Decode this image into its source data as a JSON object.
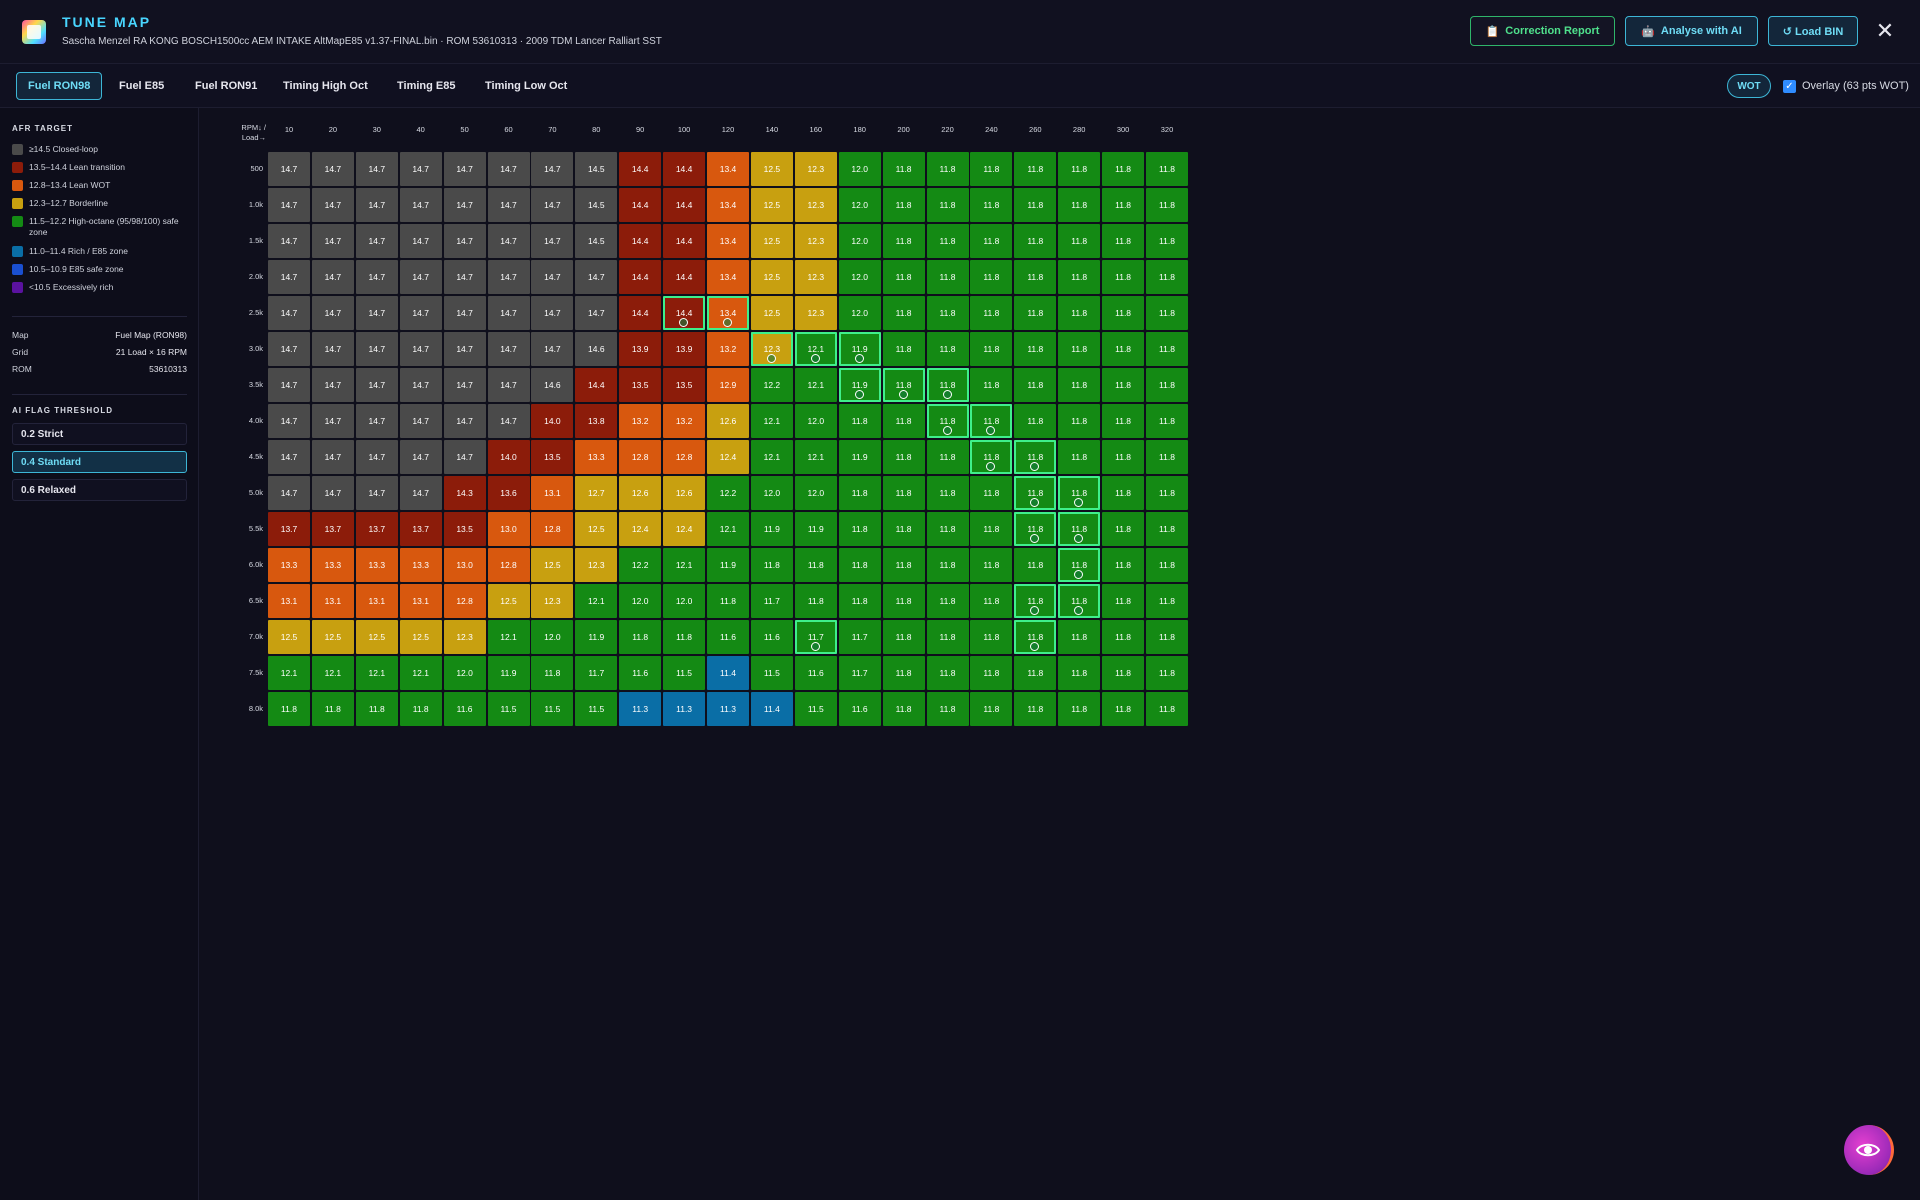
{
  "app": {
    "title": "TUNE MAP",
    "subtitle": "Sascha Menzel RA KONG BOSCH1500cc AEM INTAKE AltMapE85 v1.37-FINAL.bin · ROM 53610313 · 2009 TDM Lancer Ralliart SST"
  },
  "header": {
    "correction_label": "Correction Report",
    "analyse_label": "Analyse with AI",
    "load_label": "↺ Load BIN",
    "close_glyph": "✕"
  },
  "tabs": [
    "Fuel RON98",
    "Fuel E85",
    "Fuel RON91",
    "Timing High Oct",
    "Timing E85",
    "Timing Low Oct"
  ],
  "active_tab": 0,
  "wot_badge": "WOT",
  "overlay": {
    "checked": true,
    "label": "Overlay (63 pts WOT)"
  },
  "sidebar": {
    "legend_title": "AFR TARGET",
    "legend": [
      {
        "label": "≥14.5 Closed-loop",
        "color": "#4a4a4a"
      },
      {
        "label": "13.5–14.4 Lean transition",
        "color": "#8c1c0a"
      },
      {
        "label": "12.8–13.4 Lean WOT",
        "color": "#d8580e"
      },
      {
        "label": "12.3–12.7 Borderline",
        "color": "#c8a010"
      },
      {
        "label": "11.5–12.2 High-octane (95/98/100) safe zone",
        "color": "#148a14"
      },
      {
        "label": "11.0–11.4 Rich / E85 zone",
        "color": "#0a6ea6"
      },
      {
        "label": "10.5–10.9 E85 safe zone",
        "color": "#1a4fd0"
      },
      {
        "label": "<10.5 Excessively rich",
        "color": "#5a12a0"
      }
    ],
    "meta": [
      {
        "k": "Map",
        "v": "Fuel Map (RON98)"
      },
      {
        "k": "Grid",
        "v": "21 Load × 16 RPM"
      },
      {
        "k": "ROM",
        "v": "53610313"
      }
    ],
    "threshold_title": "AI FLAG THRESHOLD",
    "thresholds": [
      "0.2 Strict",
      "0.4 Standard",
      "0.6 Relaxed"
    ],
    "active_threshold": 1
  },
  "map": {
    "corner_label": "RPM↓ / Load→",
    "load_axis": [
      "10",
      "20",
      "30",
      "40",
      "50",
      "60",
      "70",
      "80",
      "90",
      "100",
      "120",
      "140",
      "160",
      "180",
      "200",
      "220",
      "240",
      "260",
      "280",
      "300",
      "320"
    ],
    "rpm_axis": [
      "500",
      "1.0k",
      "1.5k",
      "2.0k",
      "2.5k",
      "3.0k",
      "3.5k",
      "4.0k",
      "4.5k",
      "5.0k",
      "5.5k",
      "6.0k",
      "6.5k",
      "7.0k",
      "7.5k",
      "8.0k"
    ],
    "values": [
      [
        "14.7",
        "14.7",
        "14.7",
        "14.7",
        "14.7",
        "14.7",
        "14.7",
        "14.5",
        "14.4",
        "14.4",
        "13.4",
        "12.5",
        "12.3",
        "12.0",
        "11.8",
        "11.8",
        "11.8",
        "11.8",
        "11.8",
        "11.8",
        "11.8"
      ],
      [
        "14.7",
        "14.7",
        "14.7",
        "14.7",
        "14.7",
        "14.7",
        "14.7",
        "14.5",
        "14.4",
        "14.4",
        "13.4",
        "12.5",
        "12.3",
        "12.0",
        "11.8",
        "11.8",
        "11.8",
        "11.8",
        "11.8",
        "11.8",
        "11.8"
      ],
      [
        "14.7",
        "14.7",
        "14.7",
        "14.7",
        "14.7",
        "14.7",
        "14.7",
        "14.5",
        "14.4",
        "14.4",
        "13.4",
        "12.5",
        "12.3",
        "12.0",
        "11.8",
        "11.8",
        "11.8",
        "11.8",
        "11.8",
        "11.8",
        "11.8"
      ],
      [
        "14.7",
        "14.7",
        "14.7",
        "14.7",
        "14.7",
        "14.7",
        "14.7",
        "14.7",
        "14.4",
        "14.4",
        "13.4",
        "12.5",
        "12.3",
        "12.0",
        "11.8",
        "11.8",
        "11.8",
        "11.8",
        "11.8",
        "11.8",
        "11.8"
      ],
      [
        "14.7",
        "14.7",
        "14.7",
        "14.7",
        "14.7",
        "14.7",
        "14.7",
        "14.7",
        "14.4",
        "14.4",
        "13.4",
        "12.5",
        "12.3",
        "12.0",
        "11.8",
        "11.8",
        "11.8",
        "11.8",
        "11.8",
        "11.8",
        "11.8"
      ],
      [
        "14.7",
        "14.7",
        "14.7",
        "14.7",
        "14.7",
        "14.7",
        "14.7",
        "14.6",
        "13.9",
        "13.9",
        "13.2",
        "12.3",
        "12.1",
        "11.9",
        "11.8",
        "11.8",
        "11.8",
        "11.8",
        "11.8",
        "11.8",
        "11.8"
      ],
      [
        "14.7",
        "14.7",
        "14.7",
        "14.7",
        "14.7",
        "14.7",
        "14.6",
        "14.4",
        "13.5",
        "13.5",
        "12.9",
        "12.2",
        "12.1",
        "11.9",
        "11.8",
        "11.8",
        "11.8",
        "11.8",
        "11.8",
        "11.8",
        "11.8"
      ],
      [
        "14.7",
        "14.7",
        "14.7",
        "14.7",
        "14.7",
        "14.7",
        "14.0",
        "13.8",
        "13.2",
        "13.2",
        "12.6",
        "12.1",
        "12.0",
        "11.8",
        "11.8",
        "11.8",
        "11.8",
        "11.8",
        "11.8",
        "11.8",
        "11.8"
      ],
      [
        "14.7",
        "14.7",
        "14.7",
        "14.7",
        "14.7",
        "14.0",
        "13.5",
        "13.3",
        "12.8",
        "12.8",
        "12.4",
        "12.1",
        "12.1",
        "11.9",
        "11.8",
        "11.8",
        "11.8",
        "11.8",
        "11.8",
        "11.8",
        "11.8"
      ],
      [
        "14.7",
        "14.7",
        "14.7",
        "14.7",
        "14.3",
        "13.6",
        "13.1",
        "12.7",
        "12.6",
        "12.6",
        "12.2",
        "12.0",
        "12.0",
        "11.8",
        "11.8",
        "11.8",
        "11.8",
        "11.8",
        "11.8",
        "11.8",
        "11.8"
      ],
      [
        "13.7",
        "13.7",
        "13.7",
        "13.7",
        "13.5",
        "13.0",
        "12.8",
        "12.5",
        "12.4",
        "12.4",
        "12.1",
        "11.9",
        "11.9",
        "11.8",
        "11.8",
        "11.8",
        "11.8",
        "11.8",
        "11.8",
        "11.8",
        "11.8"
      ],
      [
        "13.3",
        "13.3",
        "13.3",
        "13.3",
        "13.0",
        "12.8",
        "12.5",
        "12.3",
        "12.2",
        "12.1",
        "11.9",
        "11.8",
        "11.8",
        "11.8",
        "11.8",
        "11.8",
        "11.8",
        "11.8",
        "11.8",
        "11.8",
        "11.8"
      ],
      [
        "13.1",
        "13.1",
        "13.1",
        "13.1",
        "12.8",
        "12.5",
        "12.3",
        "12.1",
        "12.0",
        "12.0",
        "11.8",
        "11.7",
        "11.8",
        "11.8",
        "11.8",
        "11.8",
        "11.8",
        "11.8",
        "11.8",
        "11.8",
        "11.8"
      ],
      [
        "12.5",
        "12.5",
        "12.5",
        "12.5",
        "12.3",
        "12.1",
        "12.0",
        "11.9",
        "11.8",
        "11.8",
        "11.6",
        "11.6",
        "11.7",
        "11.7",
        "11.8",
        "11.8",
        "11.8",
        "11.8",
        "11.8",
        "11.8",
        "11.8"
      ],
      [
        "12.1",
        "12.1",
        "12.1",
        "12.1",
        "12.0",
        "11.9",
        "11.8",
        "11.7",
        "11.6",
        "11.5",
        "11.4",
        "11.5",
        "11.6",
        "11.7",
        "11.8",
        "11.8",
        "11.8",
        "11.8",
        "11.8",
        "11.8",
        "11.8"
      ],
      [
        "11.8",
        "11.8",
        "11.8",
        "11.8",
        "11.6",
        "11.5",
        "11.5",
        "11.5",
        "11.3",
        "11.3",
        "11.3",
        "11.4",
        "11.5",
        "11.6",
        "11.8",
        "11.8",
        "11.8",
        "11.8",
        "11.8",
        "11.8",
        "11.8"
      ]
    ],
    "flagged": [
      [
        4,
        9
      ],
      [
        4,
        10
      ],
      [
        5,
        11
      ],
      [
        5,
        12
      ],
      [
        5,
        13
      ],
      [
        6,
        13
      ],
      [
        6,
        14
      ],
      [
        6,
        15
      ],
      [
        7,
        15
      ],
      [
        7,
        16
      ],
      [
        8,
        16
      ],
      [
        8,
        17
      ],
      [
        9,
        17
      ],
      [
        9,
        18
      ],
      [
        10,
        17
      ],
      [
        10,
        18
      ],
      [
        11,
        18
      ],
      [
        12,
        17
      ],
      [
        12,
        18
      ],
      [
        13,
        12
      ],
      [
        13,
        17
      ]
    ]
  },
  "colors": {
    "closed_loop": "#4a4a4a",
    "lean_transition": "#8c1c0a",
    "lean_wot": "#d8580e",
    "borderline": "#c8a010",
    "safe": "#148a14",
    "rich": "#0a6ea6",
    "accent": "#49d6ff",
    "flag": "#3ff08a"
  }
}
